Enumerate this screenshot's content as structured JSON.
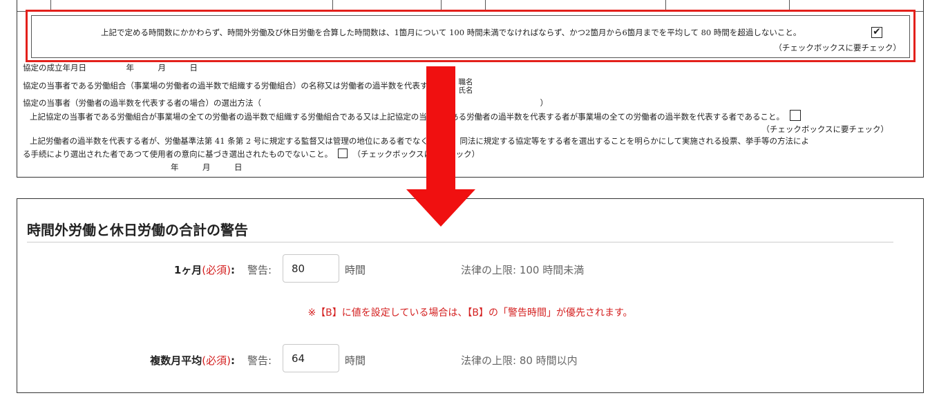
{
  "document": {
    "notice_text": "上記で定める時間数にかかわらず、時間外労働及び休日労働を合算した時間数は、1箇月について 100 時間未満でなければならず、かつ2箇月から6箇月までを平均して 80 時間を超過しないこと。",
    "notice_checked": "✔",
    "notice_checkbox_note": "（チェックボックスに要チェック）",
    "row1": "協定の成立年月日　　　　　年　　　月　　　日",
    "row2": "協定の当事者である労働組合（事業場の労働者の過半数で組織する労働組合）の名称又は労働者の過半数を代表する者の",
    "row2_pos": "職名",
    "row2_name": "氏名",
    "row3": "協定の当事者（労働者の過半数を代表する者の場合）の選出方法（",
    "row3_close": "）",
    "row4": "上記協定の当事者である労働組合が事業場の全ての労働者の過半数で組織する労働組合である又は上記協定の当事者である労働者の過半数を代表する者が事業場の全ての労働者の過半数を代表する者であること。",
    "row4_note": "（チェックボックスに要チェック）",
    "row5": "上記労働者の過半数を代表する者が、労働基準法第 41 条第 2 号に規定する監督又は管理の地位にある者でなく、かつ、同法に規定する協定等をする者を選出することを明らかにして実施される投票、挙手等の方法によ",
    "row6": "る手続により選出された者であつて使用者の意向に基づき選出されたものでないこと。",
    "row6_note": "（チェックボックスに要チェック）",
    "row7": "年　　　月　　　日"
  },
  "settings": {
    "title": "時間外労働と休日労働の合計の警告",
    "monthly": {
      "label": "1ヶ月",
      "required": "(必須)",
      "colon": ":",
      "warn_label": "警告:",
      "value": "80",
      "unit": "時間",
      "limit": "法律の上限: 100 時間未満"
    },
    "note": "※【B】に値を設定している場合は、【B】の「警告時間」が優先されます。",
    "average": {
      "label": "複数月平均",
      "required": "(必須)",
      "colon": ":",
      "warn_label": "警告:",
      "value": "64",
      "unit": "時間",
      "limit": "法律の上限: 80 時間以内"
    }
  },
  "colors": {
    "highlight": "#e3201b",
    "arrow": "#f01010",
    "required": "#d42020"
  }
}
